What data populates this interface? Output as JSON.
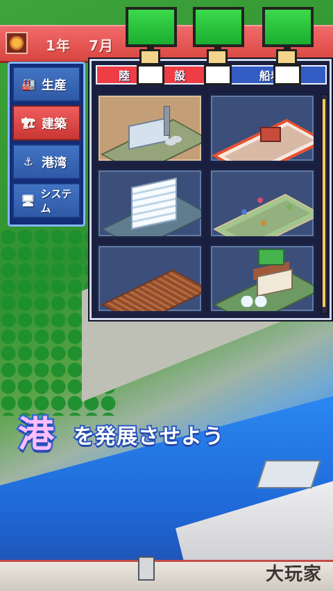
{
  "top_bar": {
    "year": "1年",
    "month": "7月"
  },
  "sidebar": {
    "items": [
      {
        "label": "生産",
        "icon": "factory-icon"
      },
      {
        "label": "建築",
        "icon": "construction-icon"
      },
      {
        "label": "港湾",
        "icon": "anchor-icon"
      },
      {
        "label": "システム",
        "icon": "monitor-icon"
      }
    ]
  },
  "tabs": {
    "left": "陸",
    "left_suffix": "設",
    "right": "船着"
  },
  "promo": {
    "main": "港",
    "sub": "を発展させよう"
  },
  "watermark": "大玩家",
  "colors": {
    "top_bar": "#e3524e",
    "sidebar": "#142d78",
    "active_tab": "#ef3d45",
    "panel_bg": "#1b1f3f",
    "promo_main": "#ffbdfd",
    "promo_outline": "#3367d2"
  }
}
